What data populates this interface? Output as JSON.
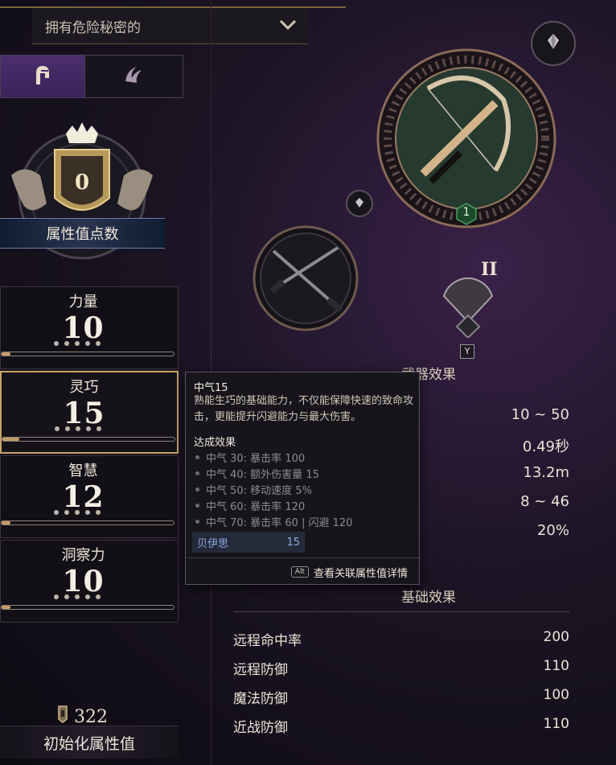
{
  "header": {
    "dropdown_value": "拥有危险秘密的",
    "dropdown_icon": "chevron-down-icon"
  },
  "class_tabs": [
    {
      "icon": "knight-helmet-icon",
      "active": true
    },
    {
      "icon": "claw-swirl-icon",
      "active": false
    }
  ],
  "attribute_points": {
    "value": "0",
    "label": "属性值点数"
  },
  "stats": [
    {
      "name": "力量",
      "value": "10",
      "progress": 0.05,
      "selected": false
    },
    {
      "name": "灵巧",
      "value": "15",
      "progress": 0.1,
      "selected": true
    },
    {
      "name": "智慧",
      "value": "12",
      "progress": 0.05,
      "selected": false
    },
    {
      "name": "洞察力",
      "value": "10",
      "progress": 0.05,
      "selected": false
    }
  ],
  "reset": {
    "count": "322",
    "label": "初始化属性值",
    "icon": "token-icon"
  },
  "weapons": {
    "main_icon": "bow-crossbow-icon",
    "main_level": "1",
    "offhand_icon": "crossed-daggers-icon",
    "rank": "II",
    "rank_key": "Y"
  },
  "weapon_effects": {
    "title": "武器效果",
    "values": [
      "10 ~ 50",
      "0.49秒",
      "13.2m",
      "8 ~ 46",
      "20%"
    ]
  },
  "base_effects": {
    "title": "基础效果",
    "rows": [
      {
        "label": "远程命中率",
        "value": "200"
      },
      {
        "label": "远程防御",
        "value": "110"
      },
      {
        "label": "魔法防御",
        "value": "100"
      },
      {
        "label": "近战防御",
        "value": "110"
      }
    ]
  },
  "tooltip": {
    "title": "中气15",
    "desc": "熟能生巧的基础能力，不仅能保障快速的致命攻击，更能提升闪避能力与最大伤害。",
    "effects_header": "达成效果",
    "effects": [
      "中气 30: 暴击率 100",
      "中气 40: 额外伤害量 15",
      "中气 50: 移动速度 5%",
      "中气 60: 暴击率 120",
      "中气 70: 暴击率 60 | 闪避 120"
    ],
    "character_name": "贝伊思",
    "character_value": "15",
    "alt_key": "Alt",
    "alt_label": "查看关联属性值详情"
  }
}
